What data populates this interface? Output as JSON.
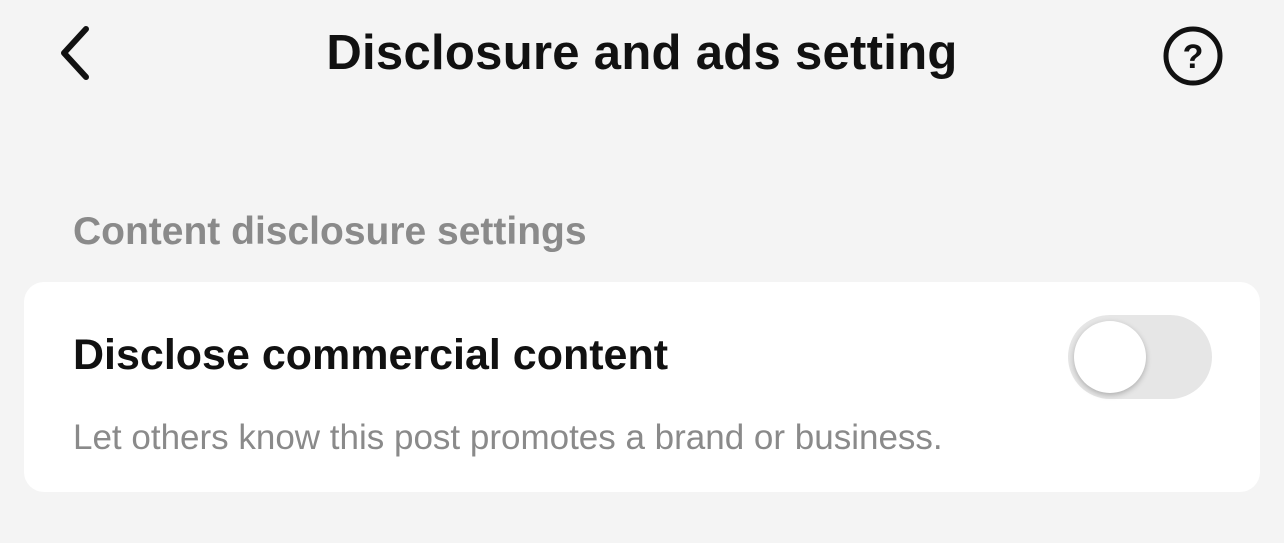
{
  "header": {
    "title": "Disclosure and ads setting",
    "back_icon": "chevron-left-icon",
    "help_icon": "question-circle-icon",
    "help_glyph": "?"
  },
  "section": {
    "label": "Content disclosure settings"
  },
  "setting": {
    "title": "Disclose commercial content",
    "description": "Let others know this post promotes a brand or business.",
    "toggle_state": "off"
  },
  "colors": {
    "background": "#f4f4f4",
    "card": "#ffffff",
    "text_primary": "#111111",
    "text_secondary": "#8a8a8a",
    "toggle_off_track": "#e6e6e6"
  }
}
